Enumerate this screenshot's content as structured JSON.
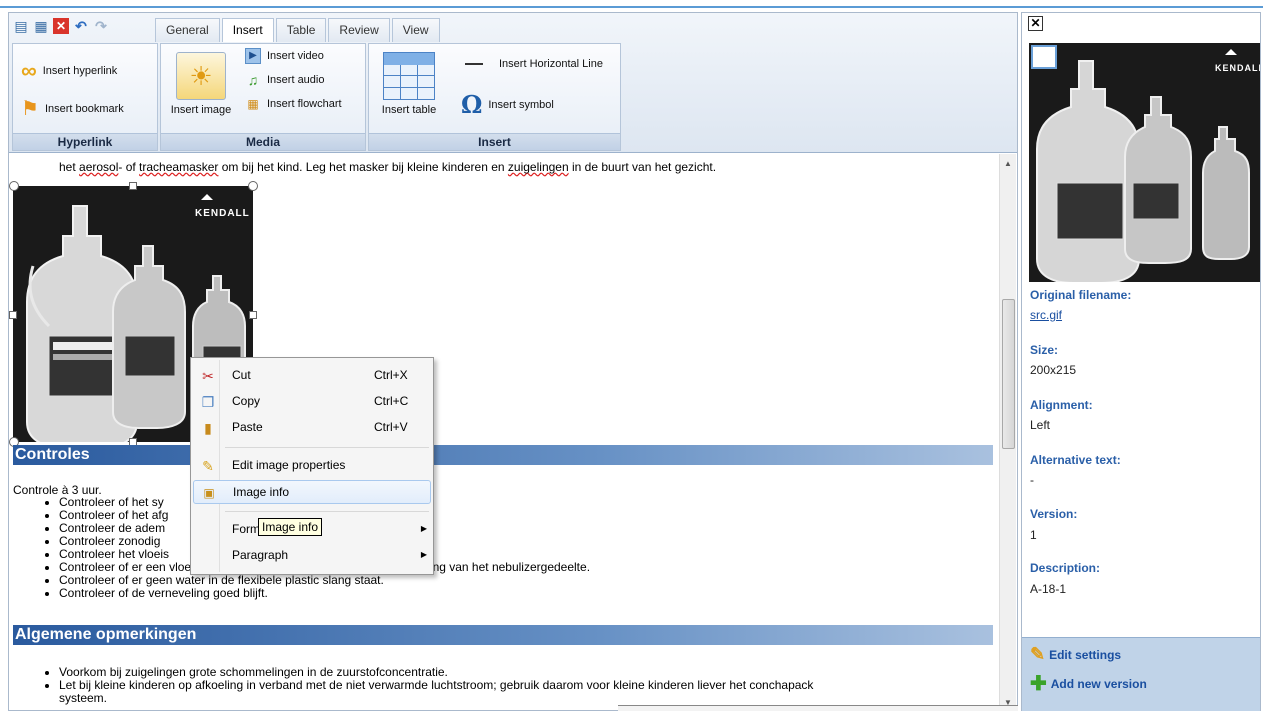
{
  "qat": {
    "icons": [
      "save-icon",
      "save-close-icon",
      "close-icon",
      "undo-icon",
      "redo-icon"
    ]
  },
  "tabs": [
    {
      "label": "General"
    },
    {
      "label": "Insert",
      "active": true
    },
    {
      "label": "Table"
    },
    {
      "label": "Review"
    },
    {
      "label": "View"
    }
  ],
  "ribbon": {
    "hyperlink": {
      "group_label": "Hyperlink",
      "insert_hyperlink": "Insert hyperlink",
      "insert_bookmark": "Insert bookmark"
    },
    "media": {
      "group_label": "Media",
      "insert_image": "Insert image",
      "insert_video": "Insert video",
      "insert_audio": "Insert audio",
      "insert_flowchart": "Insert flowchart"
    },
    "insert": {
      "group_label": "Insert",
      "insert_table": "Insert table",
      "insert_hline": "Insert Horizontal Line",
      "insert_symbol": "Insert symbol"
    }
  },
  "document": {
    "top_line_1": "het ",
    "top_line_u1": "aerosol",
    "top_line_2": "- of ",
    "top_line_u2": "tracheamasker",
    "top_line_3": " om bij het kind. Leg het masker bij kleine kinderen en ",
    "top_line_u3": "zuigelingen",
    "top_line_4": " in de buurt van het gezicht.",
    "image_brand": "KENDALL",
    "heading_1": "Controles",
    "intro": "Controle à 3 uur.",
    "list_1": [
      "Controleer of het sy",
      "Controleer of het afg",
      "Controleer de adem",
      "Controleer zonodig",
      "Controleer het vloeis",
      "Controleer of er een vloeistofstroom gehandhaafd blijft in de dunne slang van het nebulizergedeelte.",
      "Controleer of er geen water in de flexibele plastic slang staat.",
      "Controleer of de verneveling goed blijft."
    ],
    "heading_2": "Algemene opmerkingen",
    "list_2": [
      "Voorkom bij zuigelingen grote schommelingen in de zuurstofconcentratie.",
      "Let bij kleine kinderen op afkoeling in verband met de niet verwarmde luchtstroom; gebruik daarom voor kleine kinderen liever het conchapack",
      "systeem."
    ]
  },
  "context_menu": {
    "items": [
      {
        "label": "Cut",
        "shortcut": "Ctrl+X",
        "icon": "scissors-icon"
      },
      {
        "label": "Copy",
        "shortcut": "Ctrl+C",
        "icon": "copy-icon"
      },
      {
        "label": "Paste",
        "shortcut": "Ctrl+V",
        "icon": "paste-icon"
      },
      {
        "label": "Edit image properties",
        "shortcut": "",
        "icon": "edit-image-icon"
      },
      {
        "label": "Image info",
        "shortcut": "",
        "icon": "image-info-icon"
      },
      {
        "label": "Forma",
        "shortcut": "",
        "icon": "",
        "submenu": true
      },
      {
        "label": "Paragraph",
        "shortcut": "",
        "icon": "",
        "submenu": true
      }
    ],
    "tooltip": "Image info"
  },
  "panel": {
    "image_brand": "KENDALL",
    "original_filename_label": "Original filename:",
    "original_filename": "src.gif",
    "size_label": "Size:",
    "size": "200x215",
    "alignment_label": "Alignment:",
    "alignment": "Left",
    "alt_label": "Alternative text:",
    "alt": "-",
    "version_label": "Version:",
    "version": "1",
    "description_label": "Description:",
    "description": "A-18-1",
    "edit_settings": "Edit settings",
    "add_version": "Add new version"
  },
  "colors": {
    "heading_start": "#2a5a9e",
    "link_blue": "#1a4fa0",
    "panel_footer": "#c0d3e8"
  }
}
